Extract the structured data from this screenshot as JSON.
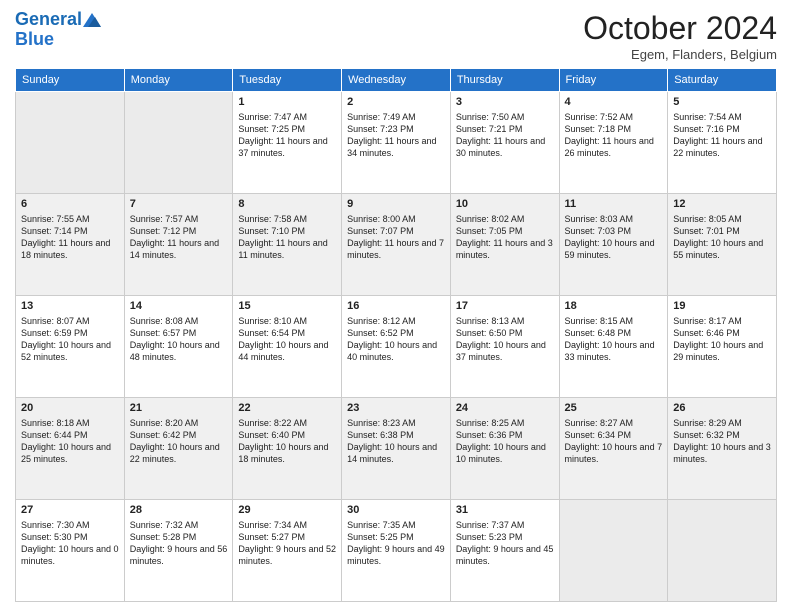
{
  "header": {
    "logo_line1": "General",
    "logo_line2": "Blue",
    "month_title": "October 2024",
    "location": "Egem, Flanders, Belgium"
  },
  "days_of_week": [
    "Sunday",
    "Monday",
    "Tuesday",
    "Wednesday",
    "Thursday",
    "Friday",
    "Saturday"
  ],
  "weeks": [
    [
      {
        "day": "",
        "content": ""
      },
      {
        "day": "",
        "content": ""
      },
      {
        "day": "1",
        "content": "Sunrise: 7:47 AM\nSunset: 7:25 PM\nDaylight: 11 hours and 37 minutes."
      },
      {
        "day": "2",
        "content": "Sunrise: 7:49 AM\nSunset: 7:23 PM\nDaylight: 11 hours and 34 minutes."
      },
      {
        "day": "3",
        "content": "Sunrise: 7:50 AM\nSunset: 7:21 PM\nDaylight: 11 hours and 30 minutes."
      },
      {
        "day": "4",
        "content": "Sunrise: 7:52 AM\nSunset: 7:18 PM\nDaylight: 11 hours and 26 minutes."
      },
      {
        "day": "5",
        "content": "Sunrise: 7:54 AM\nSunset: 7:16 PM\nDaylight: 11 hours and 22 minutes."
      }
    ],
    [
      {
        "day": "6",
        "content": "Sunrise: 7:55 AM\nSunset: 7:14 PM\nDaylight: 11 hours and 18 minutes."
      },
      {
        "day": "7",
        "content": "Sunrise: 7:57 AM\nSunset: 7:12 PM\nDaylight: 11 hours and 14 minutes."
      },
      {
        "day": "8",
        "content": "Sunrise: 7:58 AM\nSunset: 7:10 PM\nDaylight: 11 hours and 11 minutes."
      },
      {
        "day": "9",
        "content": "Sunrise: 8:00 AM\nSunset: 7:07 PM\nDaylight: 11 hours and 7 minutes."
      },
      {
        "day": "10",
        "content": "Sunrise: 8:02 AM\nSunset: 7:05 PM\nDaylight: 11 hours and 3 minutes."
      },
      {
        "day": "11",
        "content": "Sunrise: 8:03 AM\nSunset: 7:03 PM\nDaylight: 10 hours and 59 minutes."
      },
      {
        "day": "12",
        "content": "Sunrise: 8:05 AM\nSunset: 7:01 PM\nDaylight: 10 hours and 55 minutes."
      }
    ],
    [
      {
        "day": "13",
        "content": "Sunrise: 8:07 AM\nSunset: 6:59 PM\nDaylight: 10 hours and 52 minutes."
      },
      {
        "day": "14",
        "content": "Sunrise: 8:08 AM\nSunset: 6:57 PM\nDaylight: 10 hours and 48 minutes."
      },
      {
        "day": "15",
        "content": "Sunrise: 8:10 AM\nSunset: 6:54 PM\nDaylight: 10 hours and 44 minutes."
      },
      {
        "day": "16",
        "content": "Sunrise: 8:12 AM\nSunset: 6:52 PM\nDaylight: 10 hours and 40 minutes."
      },
      {
        "day": "17",
        "content": "Sunrise: 8:13 AM\nSunset: 6:50 PM\nDaylight: 10 hours and 37 minutes."
      },
      {
        "day": "18",
        "content": "Sunrise: 8:15 AM\nSunset: 6:48 PM\nDaylight: 10 hours and 33 minutes."
      },
      {
        "day": "19",
        "content": "Sunrise: 8:17 AM\nSunset: 6:46 PM\nDaylight: 10 hours and 29 minutes."
      }
    ],
    [
      {
        "day": "20",
        "content": "Sunrise: 8:18 AM\nSunset: 6:44 PM\nDaylight: 10 hours and 25 minutes."
      },
      {
        "day": "21",
        "content": "Sunrise: 8:20 AM\nSunset: 6:42 PM\nDaylight: 10 hours and 22 minutes."
      },
      {
        "day": "22",
        "content": "Sunrise: 8:22 AM\nSunset: 6:40 PM\nDaylight: 10 hours and 18 minutes."
      },
      {
        "day": "23",
        "content": "Sunrise: 8:23 AM\nSunset: 6:38 PM\nDaylight: 10 hours and 14 minutes."
      },
      {
        "day": "24",
        "content": "Sunrise: 8:25 AM\nSunset: 6:36 PM\nDaylight: 10 hours and 10 minutes."
      },
      {
        "day": "25",
        "content": "Sunrise: 8:27 AM\nSunset: 6:34 PM\nDaylight: 10 hours and 7 minutes."
      },
      {
        "day": "26",
        "content": "Sunrise: 8:29 AM\nSunset: 6:32 PM\nDaylight: 10 hours and 3 minutes."
      }
    ],
    [
      {
        "day": "27",
        "content": "Sunrise: 7:30 AM\nSunset: 5:30 PM\nDaylight: 10 hours and 0 minutes."
      },
      {
        "day": "28",
        "content": "Sunrise: 7:32 AM\nSunset: 5:28 PM\nDaylight: 9 hours and 56 minutes."
      },
      {
        "day": "29",
        "content": "Sunrise: 7:34 AM\nSunset: 5:27 PM\nDaylight: 9 hours and 52 minutes."
      },
      {
        "day": "30",
        "content": "Sunrise: 7:35 AM\nSunset: 5:25 PM\nDaylight: 9 hours and 49 minutes."
      },
      {
        "day": "31",
        "content": "Sunrise: 7:37 AM\nSunset: 5:23 PM\nDaylight: 9 hours and 45 minutes."
      },
      {
        "day": "",
        "content": ""
      },
      {
        "day": "",
        "content": ""
      }
    ]
  ]
}
